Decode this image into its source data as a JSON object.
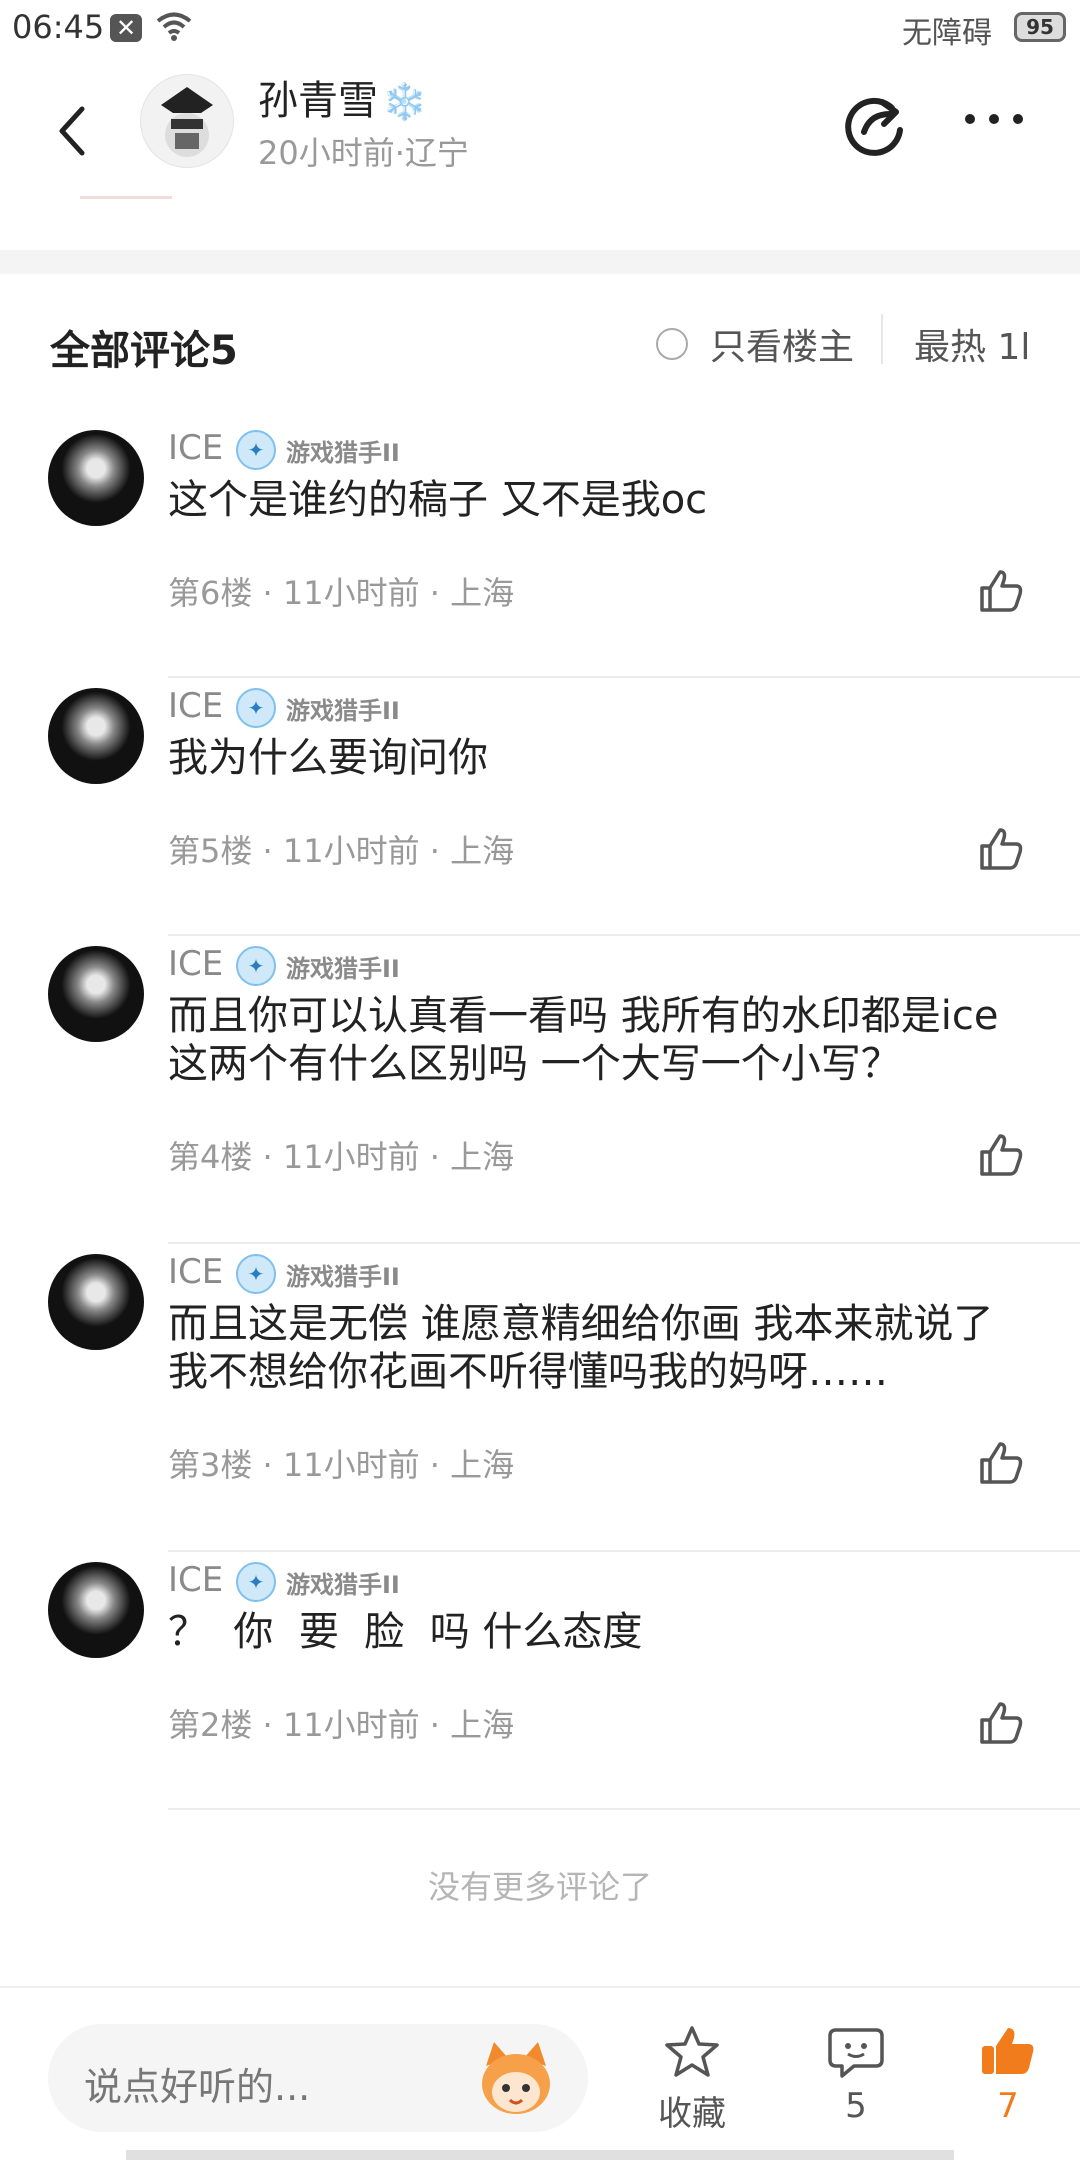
{
  "status_bar": {
    "time": "06:45",
    "accessibility_label": "无障碍",
    "battery": "95"
  },
  "post_header": {
    "author_name": "孙青雪",
    "author_emoji": "❄️",
    "meta": "20小时前·辽宁"
  },
  "comments_header": {
    "title": "全部评论5",
    "only_op_label": "只看楼主",
    "sort_label": "最热 1l"
  },
  "comments": [
    {
      "user": "ICE",
      "badge": "游戏猎手II",
      "text": "这个是谁约的稿子 又不是我oc",
      "meta": "第6楼 · 11小时前 · 上海"
    },
    {
      "user": "ICE",
      "badge": "游戏猎手II",
      "text": "我为什么要询问你",
      "meta": "第5楼 · 11小时前 · 上海"
    },
    {
      "user": "ICE",
      "badge": "游戏猎手II",
      "text": "而且你可以认真看一看吗 我所有的水印都是ice\n这两个有什么区别吗 一个大写一个小写？",
      "meta": "第4楼 · 11小时前 · 上海"
    },
    {
      "user": "ICE",
      "badge": "游戏猎手II",
      "text": "而且这是无偿 谁愿意精细给你画 我本来就说了\n我不想给你花画不听得懂吗我的妈呀……",
      "meta": "第3楼 · 11小时前 · 上海"
    },
    {
      "user": "ICE",
      "badge": "游戏猎手II",
      "text": "？  你  要  脸  吗 什么态度",
      "meta": "第2楼 · 11小时前 · 上海"
    }
  ],
  "no_more_text": "没有更多评论了",
  "bottom_bar": {
    "input_placeholder": "说点好听的...",
    "favorite_label": "收藏",
    "comment_count": "5",
    "like_count": "7"
  },
  "colors": {
    "accent_orange": "#f07c1c",
    "badge_blue": "#7ec0ee",
    "meta_gray": "#999999"
  },
  "icons": [
    "back-icon",
    "share-icon",
    "more-icon",
    "like-icon",
    "star-icon",
    "comment-icon",
    "thumb-up-filled-icon",
    "wifi-icon",
    "badge-icon",
    "mascot-icon"
  ]
}
